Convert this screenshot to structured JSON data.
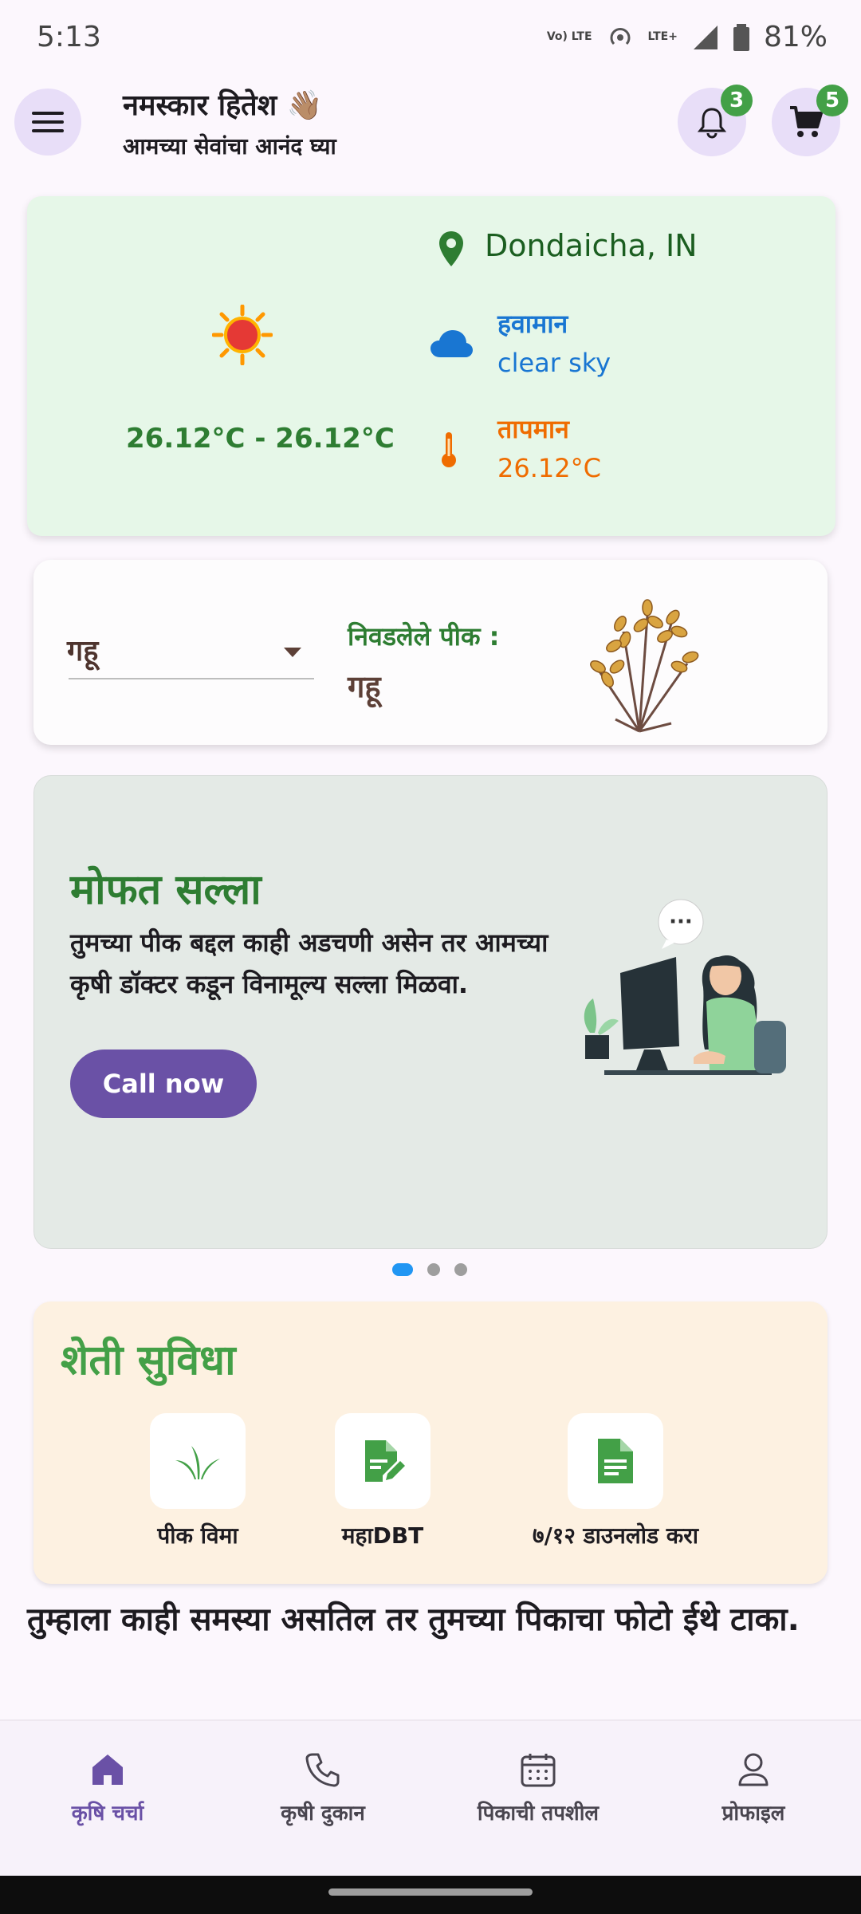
{
  "status_bar": {
    "time": "5:13",
    "volte": "Vo) LTE",
    "lte": "LTE+",
    "battery": "81%"
  },
  "header": {
    "greeting": "नमस्कार हितेश 👋🏽",
    "subtitle": "आमच्या सेवांचा आनंद घ्या",
    "notification_count": "3",
    "cart_count": "5"
  },
  "weather": {
    "location": "Dondaicha, IN",
    "temp_range": "26.12°C - 26.12°C",
    "weather_label": "हवामान",
    "weather_value": "clear sky",
    "temp_label": "तापमान",
    "temp_value": "26.12°C"
  },
  "crop": {
    "dropdown_value": "गहू",
    "selected_label": "निवडलेले पीक :",
    "selected_value": "गहू"
  },
  "banner": {
    "title": "मोफत सल्ला",
    "text": "तुमच्या पीक बद्दल काही अडचणी असेन तर आमच्या कृषी डॉक्टर कडून विनामूल्य सल्ला मिळवा.",
    "button": "Call now",
    "bubble": "···",
    "active_page": 1,
    "page_count": 3
  },
  "facilities": {
    "title": "शेती सुविधा",
    "items": [
      {
        "label": "पीक विमा",
        "icon": "sprout-icon"
      },
      {
        "label": "महाDBT",
        "icon": "document-edit-icon"
      },
      {
        "label": "७/१२ डाउनलोड करा",
        "icon": "document-icon"
      }
    ]
  },
  "problem_prompt": "तुम्हाला काही समस्या असतिल तर तुमच्या पिकाचा फोटो ईथे टाका.",
  "bottom_nav": {
    "items": [
      {
        "label": "कृषि चर्चा",
        "icon": "home-icon",
        "active": true
      },
      {
        "label": "कृषी दुकान",
        "icon": "phone-icon",
        "active": false
      },
      {
        "label": "पिकाची तपशील",
        "icon": "calendar-icon",
        "active": false
      },
      {
        "label": "प्रोफाइल",
        "icon": "profile-icon",
        "active": false
      }
    ]
  },
  "colors": {
    "primary": "#6a51a6",
    "green": "#43a047",
    "weather_bg": "#e6f7e8",
    "facility_bg": "#fdf1e1",
    "badge": "#43a047"
  }
}
